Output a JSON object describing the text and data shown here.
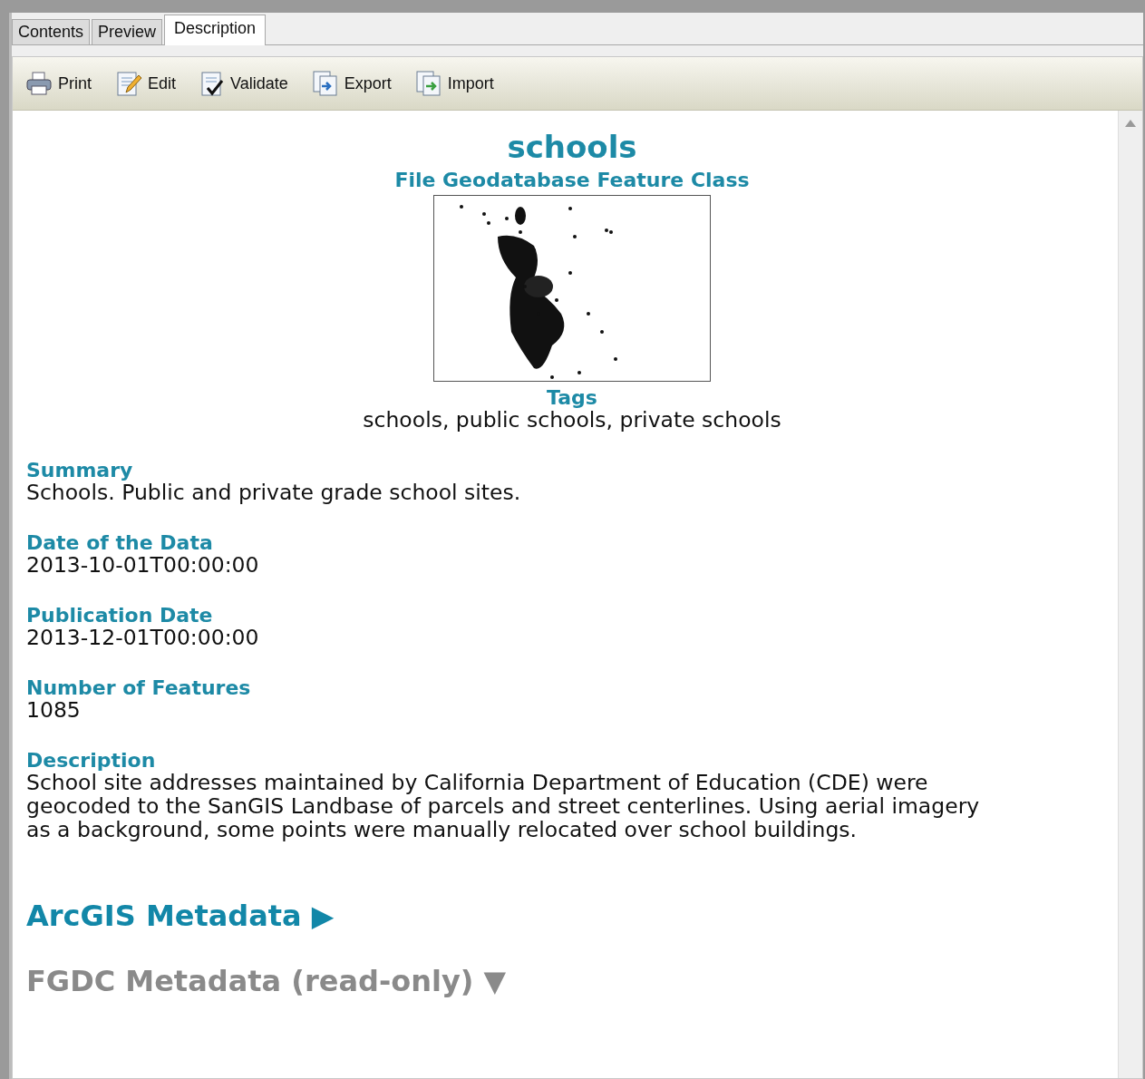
{
  "tabs": [
    {
      "label": "Contents",
      "selected": false
    },
    {
      "label": "Preview",
      "selected": false
    },
    {
      "label": "Description",
      "selected": true
    }
  ],
  "toolbar": [
    {
      "label": "Print",
      "kind": "print"
    },
    {
      "label": "Edit",
      "kind": "edit"
    },
    {
      "label": "Validate",
      "kind": "validate"
    },
    {
      "label": "Export",
      "kind": "export"
    },
    {
      "label": "Import",
      "kind": "import"
    }
  ],
  "title": "schools",
  "subtitle": "File Geodatabase Feature Class",
  "tags": {
    "label": "Tags",
    "value": "schools, public schools, private schools"
  },
  "sections": [
    {
      "label": "Summary",
      "value": "Schools. Public and private grade school sites."
    },
    {
      "label": "Date of the Data",
      "value": "2013-10-01T00:00:00"
    },
    {
      "label": "Publication Date",
      "value": "2013-12-01T00:00:00"
    },
    {
      "label": "Number of Features",
      "value": "1085"
    },
    {
      "label": "Description",
      "value": "School site addresses maintained by California Department of Education (CDE) were geocoded to the SanGIS Landbase of parcels and street centerlines. Using aerial imagery as a background, some points were manually relocated over school buildings."
    }
  ],
  "metadata_links": [
    {
      "label": "ArcGIS Metadata",
      "arrow": "▶",
      "disabled": false
    },
    {
      "label": "FGDC Metadata (read-only)",
      "arrow": "▼",
      "disabled": true
    }
  ]
}
